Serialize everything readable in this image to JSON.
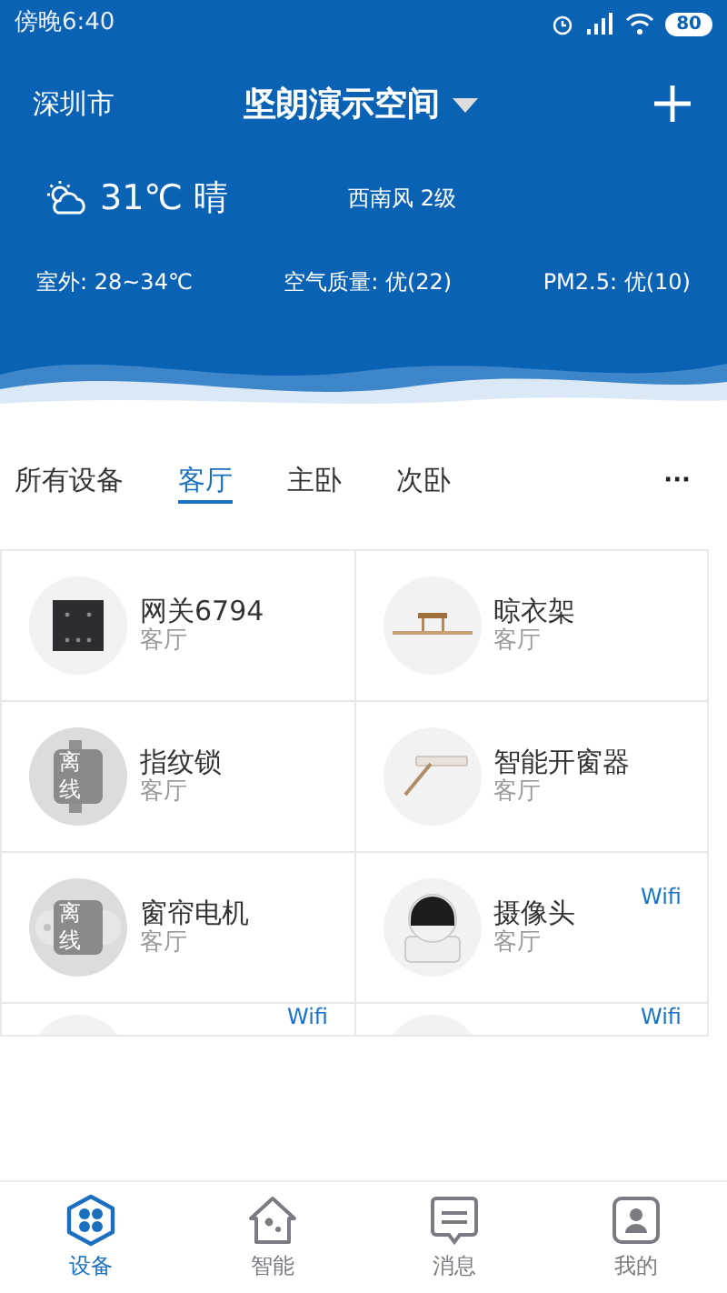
{
  "status_bar": {
    "time": "傍晚6:40",
    "battery": "80"
  },
  "header": {
    "city": "深圳市",
    "title": "坚朗演示空间"
  },
  "weather": {
    "temperature": "31℃ 晴",
    "wind": "西南风 2级",
    "outdoor": "室外: 28~34℃",
    "air_quality": "空气质量: 优(22)",
    "pm25": "PM2.5: 优(10)"
  },
  "tabs": [
    {
      "label": "所有设备",
      "selected": false
    },
    {
      "label": "客厅",
      "selected": true
    },
    {
      "label": "主卧",
      "selected": false
    },
    {
      "label": "次卧",
      "selected": false
    }
  ],
  "more": "···",
  "devices": [
    {
      "kind": "gateway",
      "name": "网关6794",
      "room": "客厅"
    },
    {
      "kind": "drying-rack",
      "name": "晾衣架",
      "room": "客厅"
    },
    {
      "kind": "lock",
      "name": "指纹锁",
      "room": "客厅",
      "offline_label": "离线"
    },
    {
      "kind": "window-opener",
      "name": "智能开窗器",
      "room": "客厅"
    },
    {
      "kind": "curtain-motor",
      "name": "窗帘电机",
      "room": "客厅",
      "offline_label": "离线"
    },
    {
      "kind": "camera",
      "name": "摄像头",
      "room": "客厅",
      "badge": "Wifi"
    },
    {
      "kind": "partial",
      "badge": "Wifi"
    },
    {
      "kind": "partial",
      "badge": "Wifi"
    }
  ],
  "bottom_nav": [
    {
      "kind": "devices",
      "label": "设备",
      "selected": true
    },
    {
      "kind": "smart",
      "label": "智能",
      "selected": false
    },
    {
      "kind": "messages",
      "label": "消息",
      "selected": false
    },
    {
      "kind": "profile",
      "label": "我的",
      "selected": false
    }
  ]
}
